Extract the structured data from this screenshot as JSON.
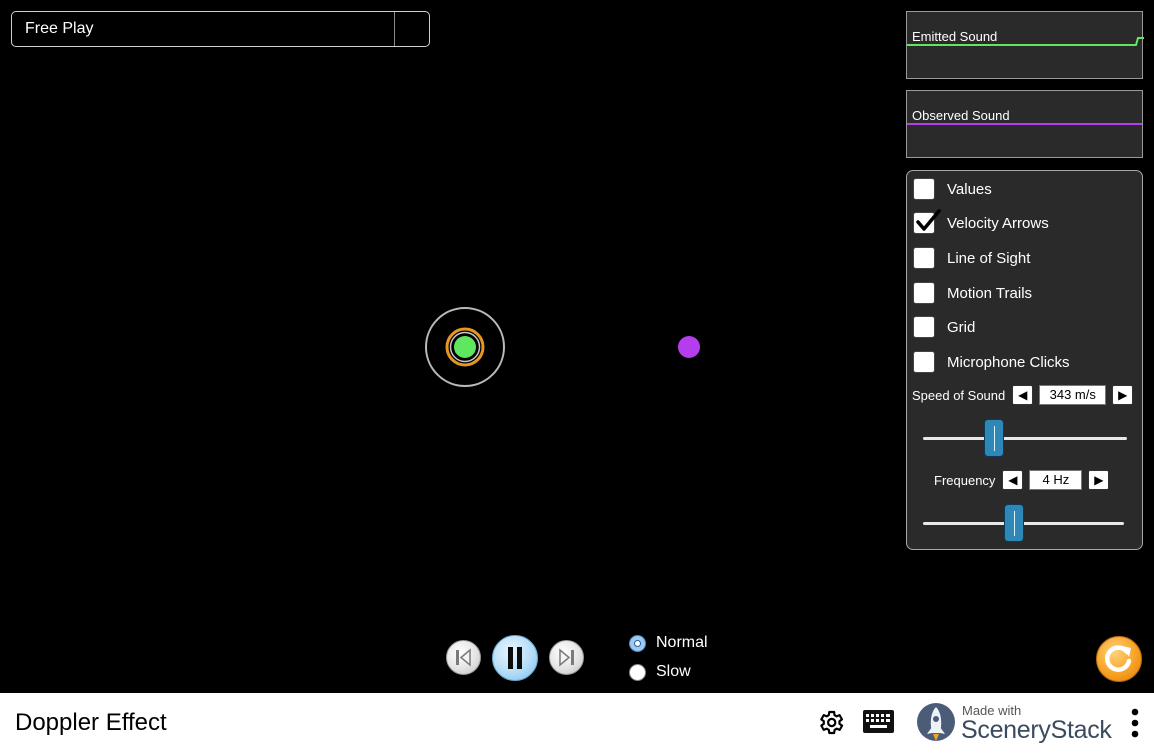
{
  "scenario": {
    "selected": "Free Play"
  },
  "graphs": {
    "emitted": {
      "label": "Emitted Sound",
      "color": "#5fe75f"
    },
    "observed": {
      "label": "Observed Sound",
      "color": "#b43df0"
    }
  },
  "options": [
    {
      "label": "Values",
      "checked": false
    },
    {
      "label": "Velocity Arrows",
      "checked": true
    },
    {
      "label": "Line of Sight",
      "checked": false
    },
    {
      "label": "Motion Trails",
      "checked": false
    },
    {
      "label": "Grid",
      "checked": false
    },
    {
      "label": "Microphone Clicks",
      "checked": false
    }
  ],
  "speed_of_sound": {
    "label": "Speed of Sound",
    "value": "343 m/s",
    "slider_fraction": 0.33
  },
  "frequency": {
    "label": "Frequency",
    "value": "4 Hz",
    "slider_fraction": 0.45
  },
  "time_speed": {
    "options": [
      {
        "label": "Normal",
        "selected": true
      },
      {
        "label": "Slow",
        "selected": false
      }
    ]
  },
  "colors": {
    "source": "#5fe75f",
    "source_ring": "#e7961f",
    "observer": "#b43df0",
    "accent": "#2e87b6"
  },
  "navbar": {
    "title": "Doppler Effect",
    "made_with": "Made with",
    "brand": "SceneryStack"
  }
}
